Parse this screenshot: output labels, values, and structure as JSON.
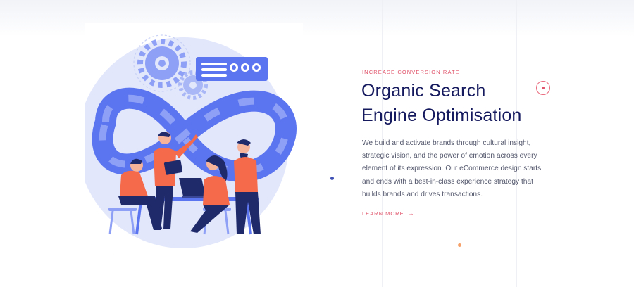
{
  "section": {
    "eyebrow": "INCREASE CONVERSION RATE",
    "title_line_1": "Organic Search",
    "title_line_2": "Engine Optimisation",
    "description": "We build and activate brands through cultural insight, strategic vision, and the power of emotion across every element of its expression. Our eCommerce design starts and ends with a best-in-class experience strategy that builds brands and drives transactions.",
    "cta_label": "LEARN MORE",
    "cta_icon": "arrow-right-icon"
  },
  "illustration": {
    "subject": "team-collaboration-illustration",
    "icons": [
      "gear-icon",
      "infinity-loop-icon",
      "settings-panel-icon",
      "laptop-icon"
    ]
  },
  "colors": {
    "accent": "#e0536a",
    "heading": "#15195e",
    "body_text": "#52566b",
    "illustration_primary": "#5b74f0",
    "illustration_light": "#dfe5fb",
    "illustration_orange": "#f46a4a",
    "dot_blue": "#3f51b5",
    "dot_orange": "#f6a06a"
  }
}
